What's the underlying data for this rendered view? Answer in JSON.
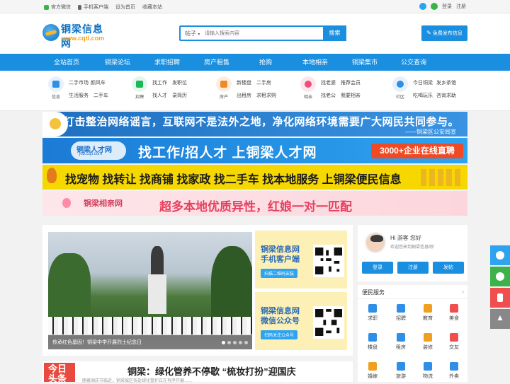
{
  "topbar": {
    "left": [
      "官方微信",
      "手机客户端",
      "设为首页",
      "收藏本站"
    ],
    "login": "登录",
    "register": "注册"
  },
  "logo": {
    "name": "铜梁信息网",
    "url": "www.cqtl.com"
  },
  "search": {
    "category": "帖子",
    "placeholder": "请输入搜索内容",
    "button": "搜索"
  },
  "publish_button": "免费发布信息",
  "nav": [
    "全站首页",
    "铜梁论坛",
    "求职招聘",
    "房产租售",
    "抢购",
    "本地相亲",
    "铜梁集市",
    "公交查询"
  ],
  "categories": [
    {
      "name": "信息",
      "color": "#2f8ee6",
      "links": [
        "二手市场",
        "颜风车",
        "生活服务",
        "二手车"
      ]
    },
    {
      "name": "招聘",
      "color": "#19b955",
      "links": [
        "找工作",
        "发职位",
        "找人才",
        "录简历"
      ]
    },
    {
      "name": "房产",
      "color": "#f08a24",
      "links": [
        "新楼盘",
        "二手房",
        "出租房",
        "求租求购"
      ]
    },
    {
      "name": "相亲",
      "color": "#f04e7c",
      "links": [
        "找老婆",
        "推荐会员",
        "找老公",
        "我要相亲"
      ]
    },
    {
      "name": "社区",
      "color": "#2f8ee6",
      "links": [
        "今日铜梁",
        "发乡茶馆",
        "吃喝玩乐",
        "咨询求助"
      ]
    }
  ],
  "banners": {
    "b1_text": "打击整治网络谣言，互联网不是法外之地，净化网络环境需要广大网民共同参与。",
    "b1_sub": "——铜梁区公安局宣",
    "b2_logo": "铜梁人才网",
    "b2_url": "job.cqtl.com",
    "b2_text": "找工作/招人才  上铜梁人才网",
    "b2_tag": "3000+企业在线直聘",
    "b3_text": "找宠物 找转让 找商铺 找家政 找二手车 找本地服务 上铜梁便民信息",
    "b4_logo": "铜梁相亲网",
    "b4_text": "超多本地优质异性，红娘一对一匹配"
  },
  "slide": {
    "caption": "传承红色基因！铜梁中学开展烈士纪念日"
  },
  "qr": [
    {
      "title1": "铜梁信息网",
      "title2": "手机客户端",
      "button": "扫描二维码安装"
    },
    {
      "title1": "铜梁信息网",
      "title2": "微信公众号",
      "button": "扫码关注公众号"
    }
  ],
  "news": {
    "badge1": "今日",
    "badge2": "头条",
    "headline": "铜梁：绿化管养不停歇 “梳妆打扮”迎国庆",
    "summary": "随着国庆节临近，铜梁城区各处绿化管护正在有序开展……"
  },
  "user": {
    "greeting": "Hi 游客 您好",
    "welcome": "欢迎您来到铜梁信息网！",
    "buttons": [
      "登录",
      "注册",
      "发帖"
    ]
  },
  "services": {
    "title": "便民服务",
    "items": [
      {
        "label": "求职",
        "color": "#2f8ee6"
      },
      {
        "label": "招聘",
        "color": "#2f8ee6"
      },
      {
        "label": "教育",
        "color": "#f0a020"
      },
      {
        "label": "美食",
        "color": "#f04e4e"
      },
      {
        "label": "楼盘",
        "color": "#2f8ee6"
      },
      {
        "label": "租房",
        "color": "#2f8ee6"
      },
      {
        "label": "装修",
        "color": "#f0a020"
      },
      {
        "label": "交友",
        "color": "#f04e4e"
      },
      {
        "label": "婚嫁",
        "color": "#f0a020"
      },
      {
        "label": "旅游",
        "color": "#2f8ee6"
      },
      {
        "label": "物流",
        "color": "#2f8ee6"
      },
      {
        "label": "外卖",
        "color": "#2f8ee6"
      }
    ]
  },
  "sidebar_float": [
    {
      "icon": "service-icon",
      "color": "#2ea3ef"
    },
    {
      "icon": "wechat-icon",
      "color": "#3cb34a"
    },
    {
      "icon": "phone-icon",
      "color": "#f04e4e"
    },
    {
      "icon": "back-to-top-icon",
      "color": "#888888"
    }
  ]
}
